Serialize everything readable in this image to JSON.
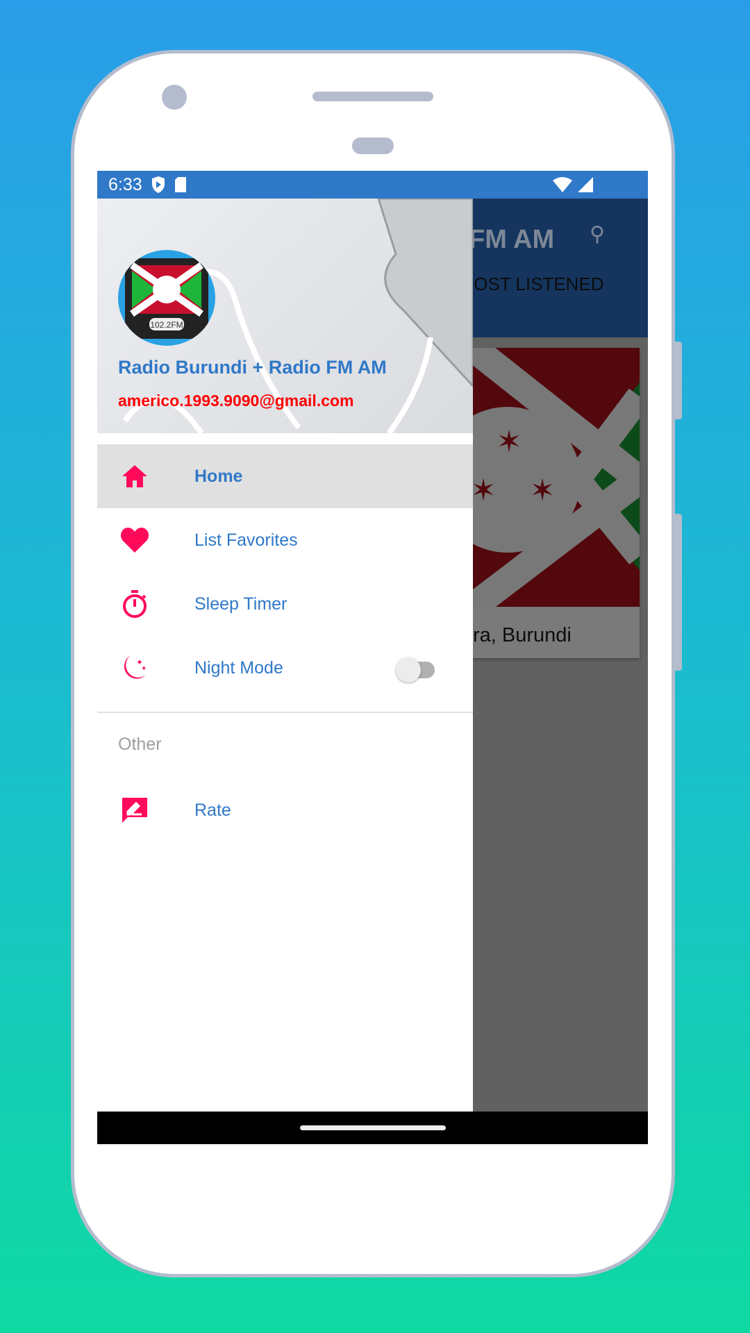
{
  "status_bar": {
    "time": "6:33",
    "icons": [
      "play-shield-icon",
      "sd-card-icon",
      "wifi-icon",
      "signal-icon"
    ]
  },
  "background_app": {
    "title_fragment": "FM AM",
    "tab_fragment": "IOST LISTENED",
    "card_caption": "ra, Burundi",
    "search_icon": "search-icon"
  },
  "drawer": {
    "header": {
      "title": "Radio Burundi + Radio FM AM",
      "email": "americo.1993.9090@gmail.com",
      "logo_frequency": "102.2FM"
    },
    "items": [
      {
        "label": "Home",
        "icon": "home-icon",
        "selected": true
      },
      {
        "label": "List Favorites",
        "icon": "heart-icon"
      },
      {
        "label": "Sleep Timer",
        "icon": "timer-icon"
      },
      {
        "label": "Night Mode",
        "icon": "moon-icon",
        "toggle_on": false
      }
    ],
    "section_other": "Other",
    "other_items": [
      {
        "label": "Rate",
        "icon": "rate-icon"
      }
    ]
  },
  "colors": {
    "accent": "#ff0a5a",
    "primary": "#3078c8",
    "email": "#ff0000"
  }
}
